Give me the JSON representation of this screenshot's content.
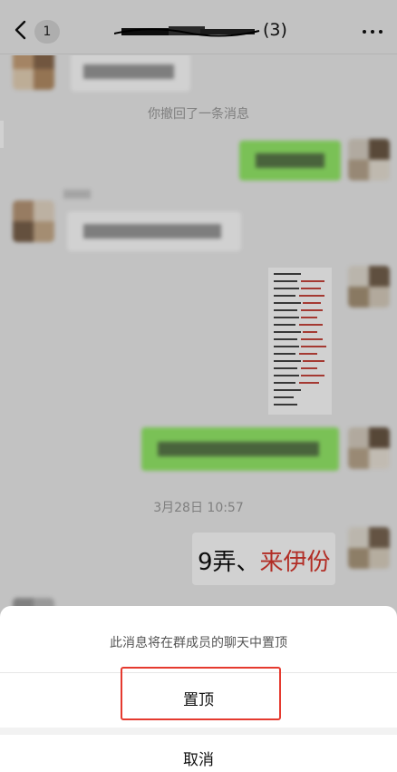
{
  "header": {
    "unread_count": "1",
    "title_count": "(3)"
  },
  "chat": {
    "recall_notice": "你撤回了一条消息",
    "timestamp": "3月28日 10:57",
    "text_part1": "9弄、",
    "text_part2": "来伊份"
  },
  "sheet": {
    "title": "此消息将在群成员的聊天中置顶",
    "pin_label": "置顶",
    "cancel_label": "取消"
  },
  "colors": {
    "green_bubble": "#95ec69",
    "highlight": "#e53a2f"
  }
}
